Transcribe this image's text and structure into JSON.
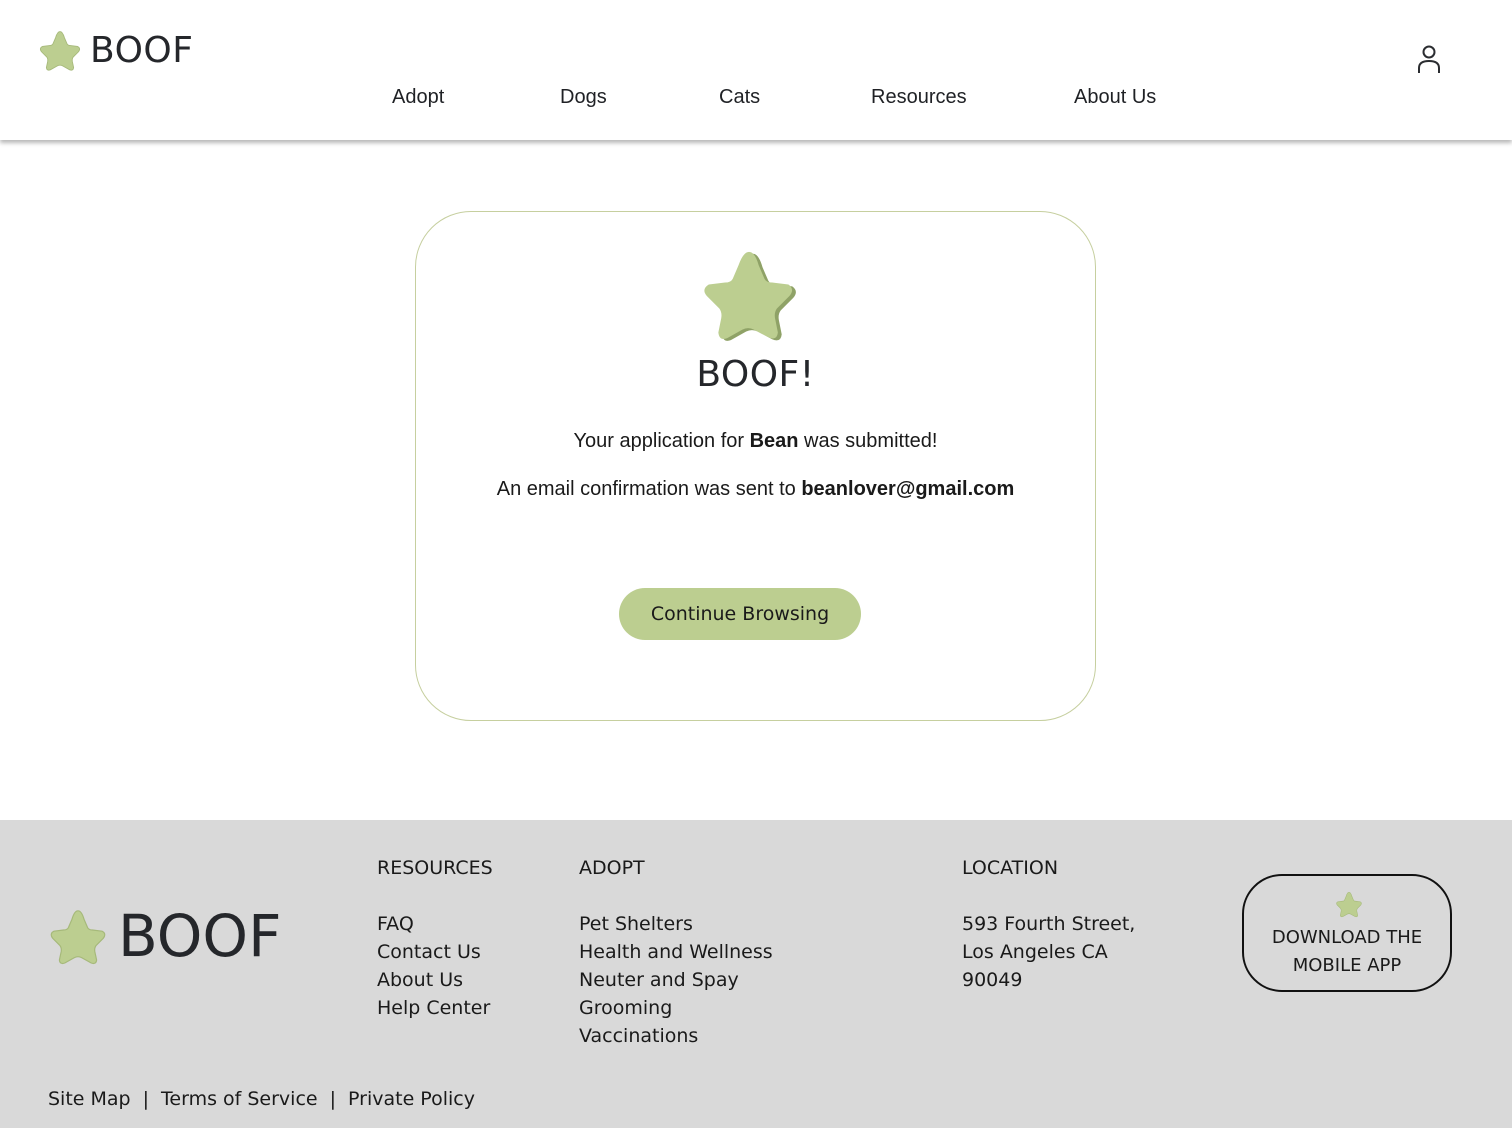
{
  "header": {
    "brand": "BOOF",
    "nav": [
      "Adopt",
      "Dogs",
      "Cats",
      "Resources",
      "About Us"
    ],
    "icons": {
      "logo": "star-icon",
      "account": "user-icon"
    }
  },
  "confirmation": {
    "title": "BOOF!",
    "line1_pre": "Your application for ",
    "pet_name": "Bean",
    "line1_post": " was submitted!",
    "line2_pre": "An email confirmation was sent to ",
    "email": "beanlover@gmail.com",
    "button": "Continue Browsing"
  },
  "footer": {
    "brand": "BOOF",
    "resources": {
      "heading": "RESOURCES",
      "links": [
        "FAQ",
        "Contact Us",
        "About Us",
        "Help Center"
      ]
    },
    "adopt": {
      "heading": "ADOPT",
      "links": [
        "Pet Shelters",
        "Health and Wellness",
        "Neuter and Spay",
        "Grooming",
        "Vaccinations"
      ]
    },
    "location": {
      "heading": "LOCATION",
      "lines": [
        "593 Fourth Street,",
        "Los Angeles CA",
        "90049"
      ]
    },
    "app_button": {
      "line1": "DOWNLOAD THE",
      "line2": "MOBILE APP"
    },
    "legal": {
      "site_map": "Site Map",
      "terms": "Terms of Service",
      "privacy": "Private Policy",
      "separator": "|"
    }
  },
  "colors": {
    "accent": "#bcce90",
    "accent_dark": "#8fa267",
    "footer_bg": "#d9d9d9",
    "card_border": "#c6cf9f"
  }
}
